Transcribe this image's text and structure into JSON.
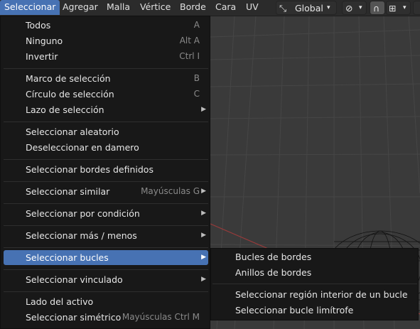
{
  "menubar": {
    "items": [
      "Seleccionar",
      "Agregar",
      "Malla",
      "Vértice",
      "Borde",
      "Cara",
      "UV"
    ],
    "transform_orientation": "Global"
  },
  "select_menu": {
    "items": [
      {
        "label": "Todos",
        "shortcut": "A"
      },
      {
        "label": "Ninguno",
        "shortcut": "Alt A"
      },
      {
        "label": "Invertir",
        "shortcut": "Ctrl I"
      },
      {
        "label": "Marco de selección",
        "shortcut": "B"
      },
      {
        "label": "Círculo de selección",
        "shortcut": "C"
      },
      {
        "label": "Lazo de selección",
        "shortcut": "",
        "submenu": true
      },
      {
        "label": "Seleccionar aleatorio",
        "shortcut": ""
      },
      {
        "label": "Deseleccionar en damero",
        "shortcut": ""
      },
      {
        "label": "Seleccionar bordes definidos",
        "shortcut": ""
      },
      {
        "label": "Seleccionar similar",
        "shortcut": "Mayúsculas G",
        "submenu": true
      },
      {
        "label": "Seleccionar por condición",
        "shortcut": "",
        "submenu": true
      },
      {
        "label": "Seleccionar más / menos",
        "shortcut": "",
        "submenu": true
      },
      {
        "label": "Seleccionar bucles",
        "shortcut": "",
        "submenu": true,
        "active": true
      },
      {
        "label": "Seleccionar vinculado",
        "shortcut": "",
        "submenu": true
      },
      {
        "label": "Lado del activo",
        "shortcut": ""
      },
      {
        "label": "Seleccionar simétrico",
        "shortcut": "Mayúsculas Ctrl M"
      }
    ]
  },
  "loops_submenu": {
    "items": [
      "Bucles de bordes",
      "Anillos de bordes",
      "Seleccionar región interior de un bucle",
      "Seleccionar bucle limítrofe"
    ]
  },
  "colors": {
    "accent": "#4772b3",
    "menu_bg": "#181818",
    "viewport_bg": "#3a3a3a"
  }
}
